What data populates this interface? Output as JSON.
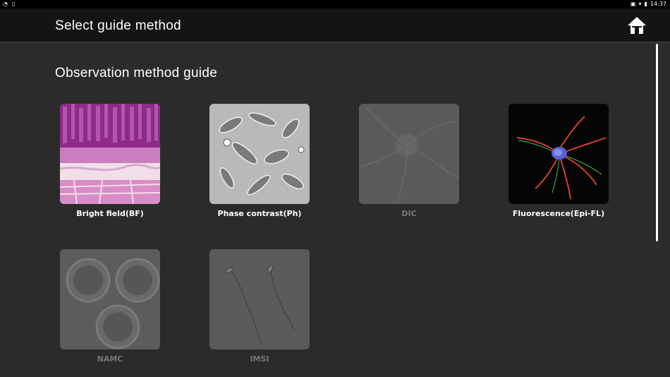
{
  "status_bar": {
    "time": "14:37"
  },
  "header": {
    "title": "Select guide method",
    "home_icon": "home-icon"
  },
  "section": {
    "title": "Observation method guide"
  },
  "methods": [
    {
      "label": "Bright field(BF)",
      "enabled": true
    },
    {
      "label": "Phase contrast(Ph)",
      "enabled": true
    },
    {
      "label": "DIC",
      "enabled": false
    },
    {
      "label": "Fluorescence(Epi-FL)",
      "enabled": true
    },
    {
      "label": "NAMC",
      "enabled": false
    },
    {
      "label": "IMSI",
      "enabled": false
    }
  ],
  "colors": {
    "background": "#2b2b2b",
    "appbar": "#141414",
    "text": "#ffffff",
    "disabled_text": "#777777"
  }
}
